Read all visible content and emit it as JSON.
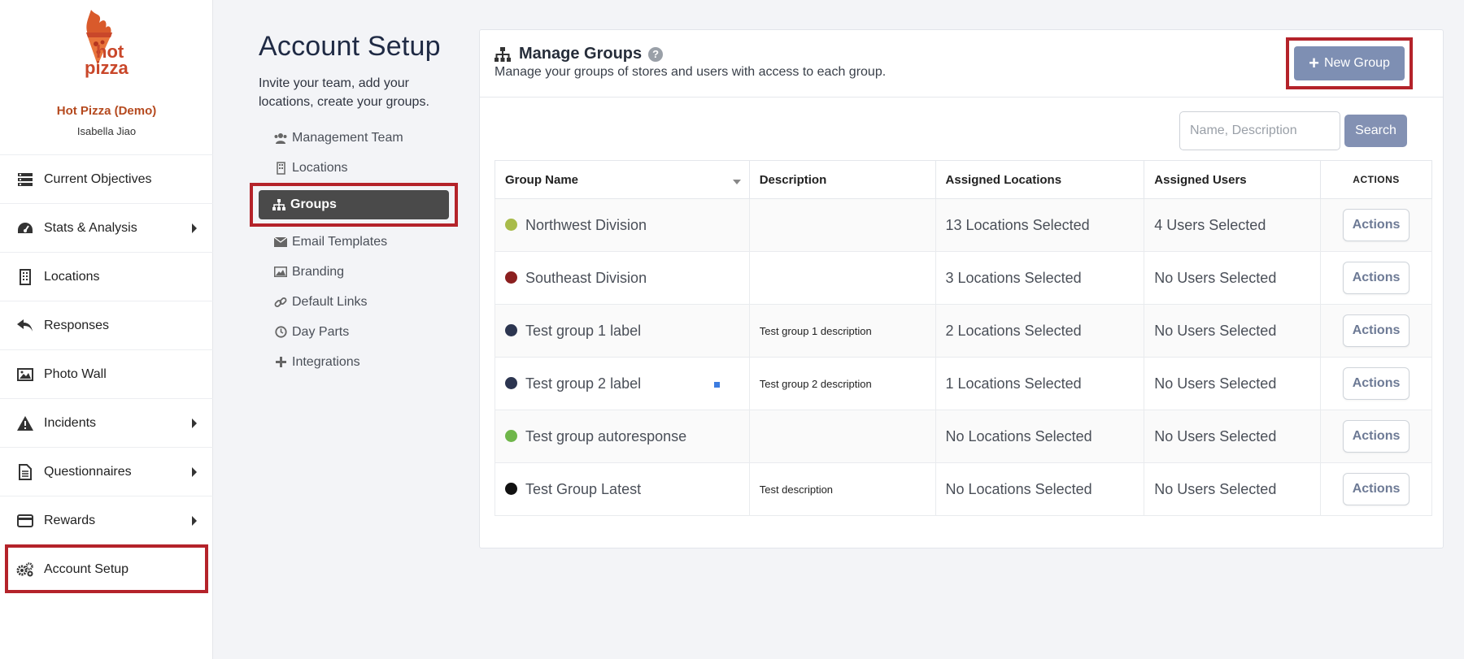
{
  "brand": {
    "logo_text_1": "hot",
    "logo_text_2": "pizza",
    "name": "Hot Pizza (Demo)",
    "user": "Isabella Jiao",
    "accent": "#b54a1f"
  },
  "sidebar": {
    "items": [
      {
        "label": "Current Objectives",
        "icon": "objectives-icon",
        "has_submenu": false
      },
      {
        "label": "Stats & Analysis",
        "icon": "dashboard-icon",
        "has_submenu": true
      },
      {
        "label": "Locations",
        "icon": "building-icon",
        "has_submenu": false
      },
      {
        "label": "Responses",
        "icon": "reply-icon",
        "has_submenu": false
      },
      {
        "label": "Photo Wall",
        "icon": "image-icon",
        "has_submenu": false
      },
      {
        "label": "Incidents",
        "icon": "warning-icon",
        "has_submenu": true
      },
      {
        "label": "Questionnaires",
        "icon": "document-icon",
        "has_submenu": true
      },
      {
        "label": "Rewards",
        "icon": "credit-card-icon",
        "has_submenu": true
      },
      {
        "label": "Account Setup",
        "icon": "gears-icon",
        "has_submenu": false,
        "active": true
      }
    ]
  },
  "setup": {
    "title": "Account Setup",
    "subtitle": "Invite your team, add your locations, create your groups.",
    "menu": [
      {
        "label": "Management Team",
        "icon": "users-icon"
      },
      {
        "label": "Locations",
        "icon": "building-icon"
      },
      {
        "label": "Groups",
        "icon": "sitemap-icon",
        "selected": true
      },
      {
        "label": "Email Templates",
        "icon": "envelope-icon"
      },
      {
        "label": "Branding",
        "icon": "image-icon"
      },
      {
        "label": "Default Links",
        "icon": "link-icon"
      },
      {
        "label": "Day Parts",
        "icon": "clock-icon"
      },
      {
        "label": "Integrations",
        "icon": "plus-icon"
      }
    ]
  },
  "panel": {
    "title": "Manage Groups",
    "help": "?",
    "subtitle": "Manage your groups of stores and users with access to each group.",
    "new_group_label": "New Group",
    "search_placeholder": "Name, Description",
    "search_label": "Search",
    "columns": [
      "Group Name",
      "Description",
      "Assigned Locations",
      "Assigned Users",
      "ACTIONS"
    ],
    "rows": [
      {
        "name": "Northwest Division",
        "color": "#a8bb4a",
        "description": "",
        "locations": "13 Locations Selected",
        "users": "4 Users Selected",
        "action": "Actions"
      },
      {
        "name": "Southeast Division",
        "color": "#8b1f1f",
        "description": "",
        "locations": "3 Locations Selected",
        "users": "No Users Selected",
        "action": "Actions"
      },
      {
        "name": "Test group 1 label",
        "color": "#2c3550",
        "description": "Test group 1 description",
        "locations": "2 Locations Selected",
        "users": "No Users Selected",
        "action": "Actions"
      },
      {
        "name": "Test group 2 label",
        "color": "#2c3550",
        "description": "Test group 2 description",
        "locations": "1 Locations Selected",
        "users": "No Users Selected",
        "action": "Actions",
        "marker": true
      },
      {
        "name": "Test group autoresponse",
        "color": "#6fb64a",
        "description": "",
        "locations": "No Locations Selected",
        "users": "No Users Selected",
        "action": "Actions"
      },
      {
        "name": "Test Group Latest",
        "color": "#111111",
        "description": "Test description",
        "locations": "No Locations Selected",
        "users": "No Users Selected",
        "action": "Actions"
      }
    ]
  }
}
